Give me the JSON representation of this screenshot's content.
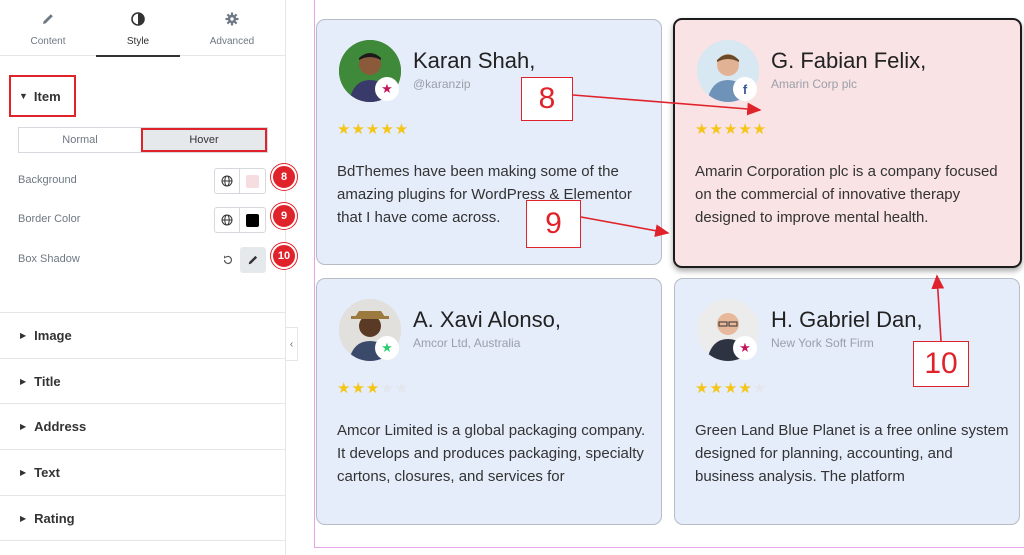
{
  "tabs": [
    {
      "label": "Content",
      "icon": "pencil-icon"
    },
    {
      "label": "Style",
      "icon": "half-circle-icon",
      "active": true
    },
    {
      "label": "Advanced",
      "icon": "gear-icon"
    }
  ],
  "item_section": {
    "label": "Item"
  },
  "state_toggle": {
    "normal": "Normal",
    "hover": "Hover",
    "selected": "Hover"
  },
  "controls": [
    {
      "label": "Background",
      "badge": "8",
      "swatch_color": "#f5dde0"
    },
    {
      "label": "Border Color",
      "badge": "9",
      "swatch_color": "#000000"
    },
    {
      "label": "Box Shadow",
      "badge": "10"
    }
  ],
  "accordion": [
    "Image",
    "Title",
    "Address",
    "Text",
    "Rating"
  ],
  "cards": [
    {
      "name": "Karan Shah,",
      "address": "@karanzip",
      "rating": 5,
      "badge_icon": "star-icon",
      "badge_color": "#c2185b",
      "text": [
        "BdThemes have been making some of the",
        "amazing plugins for WordPress & Elementor",
        "that I have come across."
      ]
    },
    {
      "name": "G. Fabian Felix,",
      "address": "Amarin Corp plc",
      "rating": 5,
      "badge_icon": "facebook-icon",
      "badge_color": "#3b5998",
      "text": [
        "Amarin Corporation plc is a company focused",
        "on the commercial of innovative therapy",
        "designed to improve mental health."
      ]
    },
    {
      "name": "A. Xavi Alonso,",
      "address": "Amcor Ltd, Australia",
      "rating": 3,
      "badge_icon": "star-icon",
      "badge_color": "#2ecc71",
      "text": [
        "Amcor Limited is a global packaging company.",
        "It develops and produces packaging, specialty",
        "cartons, closures, and services for"
      ]
    },
    {
      "name": "H. Gabriel Dan,",
      "address": "New York Soft Firm",
      "rating": 4,
      "badge_icon": "star-icon",
      "badge_color": "#c2185b",
      "text": [
        "Green Land Blue Planet is a free online system",
        "designed for planning, accounting, and",
        "business analysis. The platform"
      ]
    }
  ],
  "callouts": [
    "8",
    "9",
    "10"
  ],
  "colors": {
    "accent": "#e0232b",
    "card_bg": "#e5ecfa",
    "card_hover_bg": "#f9e3e4",
    "star": "#f5c518"
  }
}
